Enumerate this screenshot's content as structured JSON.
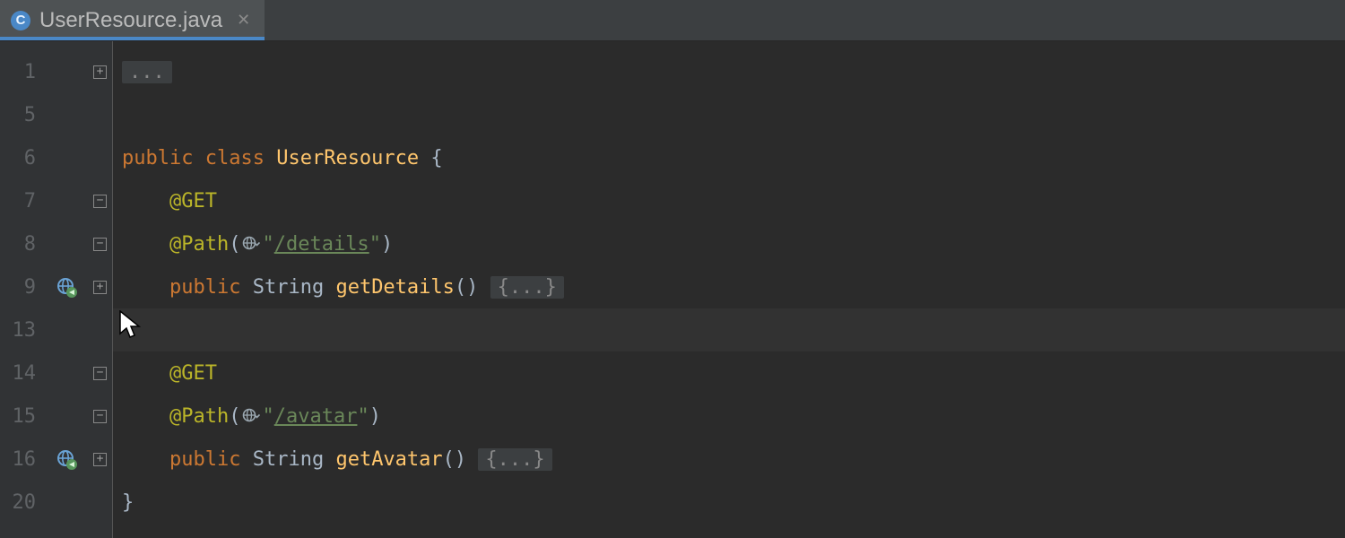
{
  "tab": {
    "filename": "UserResource.java",
    "icon_letter": "C"
  },
  "code": {
    "lines": [
      {
        "n": 1,
        "fold": "plus",
        "tokens": [
          {
            "t": "fold",
            "v": "..."
          }
        ]
      },
      {
        "n": 5,
        "fold": "",
        "tokens": []
      },
      {
        "n": 6,
        "fold": "",
        "tokens": [
          {
            "t": "kw",
            "v": "public"
          },
          {
            "t": "sp",
            "v": " "
          },
          {
            "t": "kw",
            "v": "class"
          },
          {
            "t": "sp",
            "v": " "
          },
          {
            "t": "name",
            "v": "UserResource"
          },
          {
            "t": "sp",
            "v": " "
          },
          {
            "t": "pun",
            "v": "{"
          }
        ]
      },
      {
        "n": 7,
        "fold": "minus",
        "tokens": [
          {
            "t": "sp",
            "v": "    "
          },
          {
            "t": "ann",
            "v": "@GET"
          }
        ]
      },
      {
        "n": 8,
        "fold": "minus",
        "tokens": [
          {
            "t": "sp",
            "v": "    "
          },
          {
            "t": "ann",
            "v": "@Path"
          },
          {
            "t": "par",
            "v": "("
          },
          {
            "t": "globe"
          },
          {
            "t": "str",
            "v": "\""
          },
          {
            "t": "stru",
            "v": "/details"
          },
          {
            "t": "str",
            "v": "\""
          },
          {
            "t": "par",
            "v": ")"
          }
        ]
      },
      {
        "n": 9,
        "fold": "plus",
        "gutter": "endpoint",
        "tokens": [
          {
            "t": "sp",
            "v": "    "
          },
          {
            "t": "kw",
            "v": "public"
          },
          {
            "t": "sp",
            "v": " "
          },
          {
            "t": "ty",
            "v": "String"
          },
          {
            "t": "sp",
            "v": " "
          },
          {
            "t": "mth",
            "v": "getDetails"
          },
          {
            "t": "par",
            "v": "()"
          },
          {
            "t": "sp",
            "v": " "
          },
          {
            "t": "fold",
            "v": "{...}"
          }
        ]
      },
      {
        "n": 13,
        "fold": "",
        "current": true,
        "tokens": []
      },
      {
        "n": 14,
        "fold": "minus",
        "tokens": [
          {
            "t": "sp",
            "v": "    "
          },
          {
            "t": "ann",
            "v": "@GET"
          }
        ]
      },
      {
        "n": 15,
        "fold": "minus",
        "tokens": [
          {
            "t": "sp",
            "v": "    "
          },
          {
            "t": "ann",
            "v": "@Path"
          },
          {
            "t": "par",
            "v": "("
          },
          {
            "t": "globe"
          },
          {
            "t": "str",
            "v": "\""
          },
          {
            "t": "stru",
            "v": "/avatar"
          },
          {
            "t": "str",
            "v": "\""
          },
          {
            "t": "par",
            "v": ")"
          }
        ]
      },
      {
        "n": 16,
        "fold": "plus",
        "gutter": "endpoint",
        "tokens": [
          {
            "t": "sp",
            "v": "    "
          },
          {
            "t": "kw",
            "v": "public"
          },
          {
            "t": "sp",
            "v": " "
          },
          {
            "t": "ty",
            "v": "String"
          },
          {
            "t": "sp",
            "v": " "
          },
          {
            "t": "mth",
            "v": "getAvatar"
          },
          {
            "t": "par",
            "v": "()"
          },
          {
            "t": "sp",
            "v": " "
          },
          {
            "t": "fold",
            "v": "{...}"
          }
        ]
      },
      {
        "n": 20,
        "fold": "",
        "tokens": [
          {
            "t": "pun",
            "v": "}"
          }
        ]
      }
    ]
  }
}
